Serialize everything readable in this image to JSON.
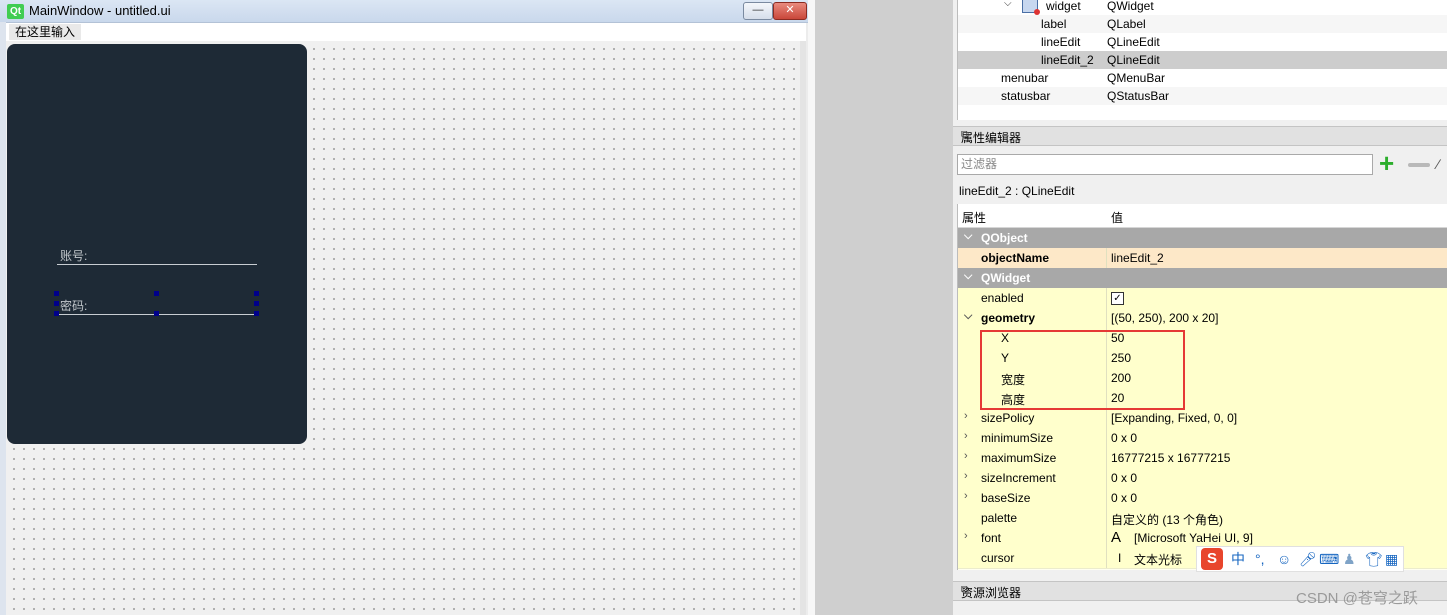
{
  "window": {
    "logo": "Qt",
    "title": "MainWindow - untitled.ui",
    "minimize_icon": "minimize-icon",
    "close_icon": "close-icon"
  },
  "menubar": {
    "item": "在这里输入"
  },
  "form": {
    "account_label": "账号:",
    "password_label": "密码:",
    "card_color": "#1e2a36"
  },
  "object_tree": {
    "rows": [
      {
        "name": "widget",
        "class": "QWidget"
      },
      {
        "name": "label",
        "class": "QLabel"
      },
      {
        "name": "lineEdit",
        "class": "QLineEdit"
      },
      {
        "name": "lineEdit_2",
        "class": "QLineEdit",
        "selected": true
      },
      {
        "name": "menubar",
        "class": "QMenuBar"
      },
      {
        "name": "statusbar",
        "class": "QStatusBar"
      }
    ]
  },
  "property_editor": {
    "title": "属性编辑器",
    "filter_placeholder": "过滤器",
    "object_label": "lineEdit_2 : QLineEdit",
    "header": {
      "property": "属性",
      "value": "值"
    },
    "groups": {
      "qobject": "QObject",
      "qwidget": "QWidget"
    },
    "rows": {
      "objectName": {
        "k": "objectName",
        "v": "lineEdit_2"
      },
      "enabled": {
        "k": "enabled",
        "checked": "✓"
      },
      "geometry": {
        "k": "geometry",
        "v": "[(50, 250), 200 x 20]"
      },
      "x": {
        "k": "X",
        "v": "50"
      },
      "y": {
        "k": "Y",
        "v": "250"
      },
      "width": {
        "k": "宽度",
        "v": "200"
      },
      "height": {
        "k": "高度",
        "v": "20"
      },
      "sizePolicy": {
        "k": "sizePolicy",
        "v": "[Expanding, Fixed, 0, 0]"
      },
      "minimumSize": {
        "k": "minimumSize",
        "v": "0 x 0"
      },
      "maximumSize": {
        "k": "maximumSize",
        "v": "16777215 x 16777215"
      },
      "sizeIncrement": {
        "k": "sizeIncrement",
        "v": "0 x 0"
      },
      "baseSize": {
        "k": "baseSize",
        "v": "0 x 0"
      },
      "palette": {
        "k": "palette",
        "v": "自定义的 (13 个角色)"
      },
      "font": {
        "k": "font",
        "v": "[Microsoft YaHei UI, 9]",
        "glyph": "A"
      },
      "cursor": {
        "k": "cursor",
        "v": "文本光标",
        "glyph": "I"
      }
    }
  },
  "ime": {
    "logo": "S",
    "lang": "中",
    "punct": "°,",
    "emoji": "☺"
  },
  "resource_browser": {
    "title": "资源浏览器"
  },
  "watermark": "CSDN @苍穹之跃"
}
